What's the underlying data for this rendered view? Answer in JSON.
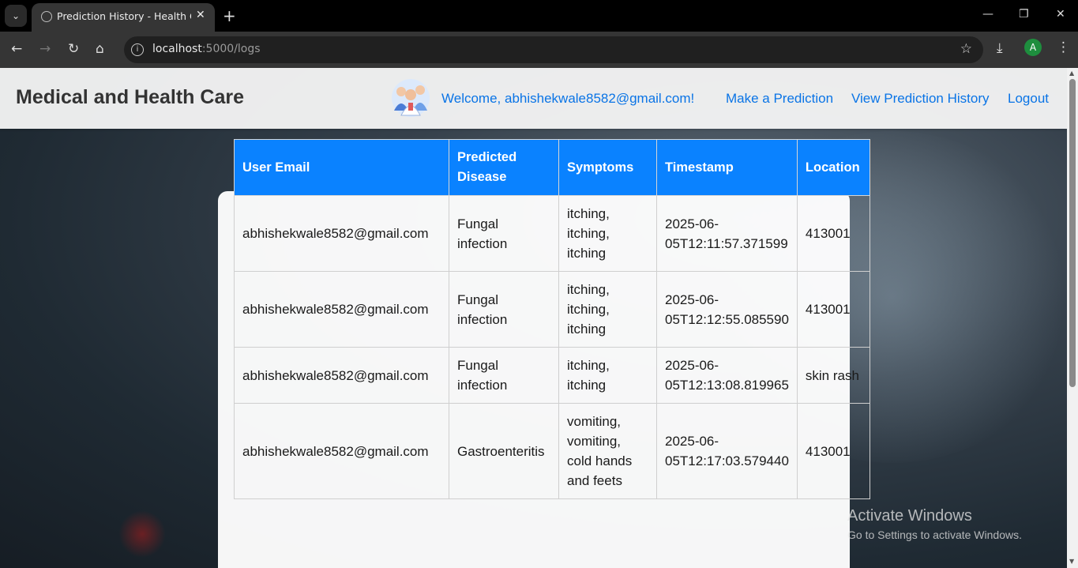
{
  "browser": {
    "tab_title": "Prediction History - Health Care",
    "url_host": "localhost",
    "url_path": ":5000/logs",
    "profile_initial": "A"
  },
  "navbar": {
    "brand": "Medical and Health Care",
    "welcome": "Welcome, abhishekwale8582@gmail.com!",
    "links": [
      "Make a Prediction",
      "View Prediction History",
      "Logout"
    ]
  },
  "table": {
    "headers": [
      "User Email",
      "Predicted Disease",
      "Symptoms",
      "Timestamp",
      "Location"
    ],
    "rows": [
      [
        "abhishekwale8582@gmail.com",
        "Fungal infection",
        "itching, itching, itching",
        "2025-06-05T12:11:57.371599",
        "413001"
      ],
      [
        "abhishekwale8582@gmail.com",
        "Fungal infection",
        "itching, itching, itching",
        "2025-06-05T12:12:55.085590",
        "413001"
      ],
      [
        "abhishekwale8582@gmail.com",
        "Fungal infection",
        "itching, itching",
        "2025-06-05T12:13:08.819965",
        "skin rash"
      ],
      [
        "abhishekwale8582@gmail.com",
        "Gastroenteritis",
        "vomiting, vomiting, cold hands and feets",
        "2025-06-05T12:17:03.579440",
        "413001"
      ]
    ]
  },
  "watermark": {
    "line1": "Activate Windows",
    "line2": "Go to Settings to activate Windows."
  },
  "colors": {
    "accent": "#0a82ff",
    "link": "#0a74e6",
    "profile": "#1e8e3e"
  }
}
